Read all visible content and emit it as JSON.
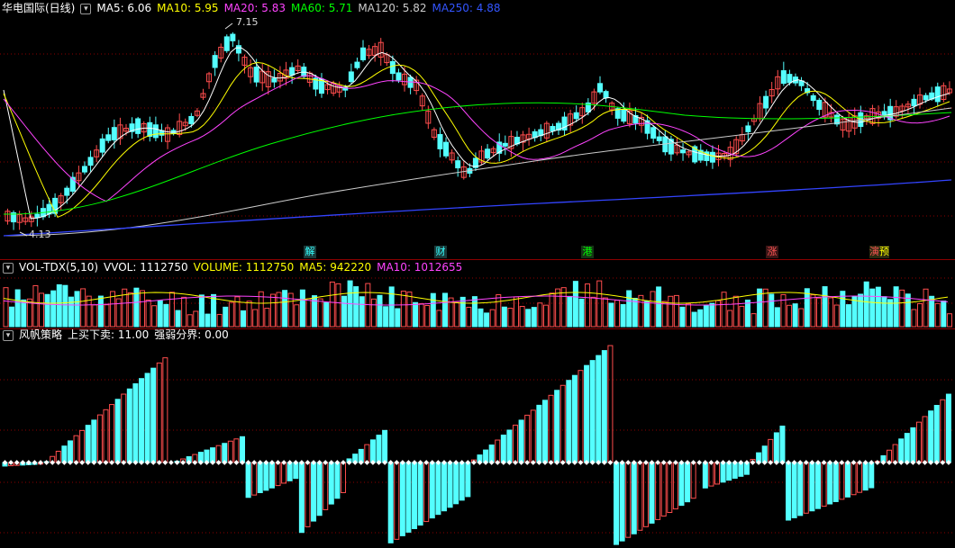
{
  "price": {
    "title": "华电国际(日线)",
    "ma": [
      {
        "label": "MA5: 6.06",
        "color": "#ffffff"
      },
      {
        "label": "MA10: 5.95",
        "color": "#ffff00"
      },
      {
        "label": "MA20: 5.83",
        "color": "#ff44ff"
      },
      {
        "label": "MA60: 5.71",
        "color": "#00ff00"
      },
      {
        "label": "MA120: 5.82",
        "color": "#cccccc"
      },
      {
        "label": "MA250: 4.88",
        "color": "#3333ff"
      }
    ],
    "high_label": "7.15",
    "low_label": "4.13",
    "events": [
      {
        "label": "解",
        "color": "#33ffff"
      },
      {
        "label": "财",
        "color": "#33ffff"
      },
      {
        "label": "港",
        "color": "#00ff00"
      },
      {
        "label": "涨",
        "color": "#ff4444"
      },
      {
        "label": "预",
        "color": "#ffff00"
      }
    ]
  },
  "volume": {
    "title": "VOL-TDX(5,10)",
    "items": [
      {
        "label": "VVOL: 1112750",
        "color": "#ffffff"
      },
      {
        "label": "VOLUME: 1112750",
        "color": "#ffff00"
      },
      {
        "label": "MA5: 942220",
        "color": "#ffff00"
      },
      {
        "label": "MA10: 1012655",
        "color": "#ff44ff"
      }
    ]
  },
  "strategy": {
    "title": "风帆策略",
    "items": [
      {
        "label": "上买下卖: 11.00",
        "color": "#ffffff"
      },
      {
        "label": "强弱分界: 0.00",
        "color": "#ffffff"
      }
    ]
  },
  "colors": {
    "up": "#ff4d4d",
    "down": "#54ffff",
    "grid": "#8b0000"
  }
}
